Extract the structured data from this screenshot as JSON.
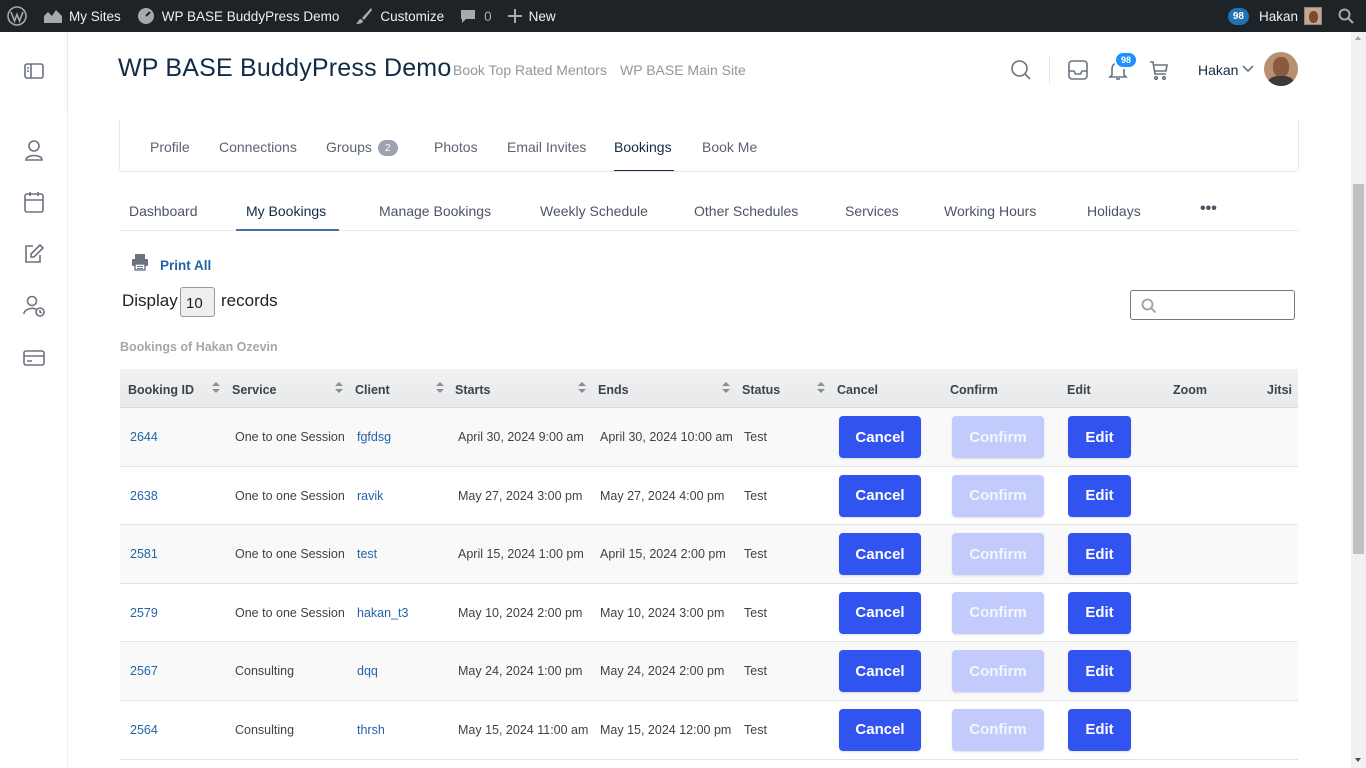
{
  "admin_bar": {
    "my_sites": "My Sites",
    "site_name": "WP BASE BuddyPress Demo",
    "customize": "Customize",
    "comments_count": "0",
    "new_label": "New",
    "updates_badge": "98",
    "user": "Hakan"
  },
  "header": {
    "site_title": "WP BASE BuddyPress Demo",
    "nav": [
      "Book Top Rated Mentors",
      "WP BASE Main Site"
    ],
    "notification_count": "98",
    "user_name": "Hakan"
  },
  "profile_nav": {
    "items": [
      "Profile",
      "Connections",
      "Groups",
      "Photos",
      "Email Invites",
      "Bookings",
      "Book Me"
    ],
    "groups_count": "2",
    "active": "Bookings"
  },
  "sub_nav": {
    "items": [
      "Dashboard",
      "My Bookings",
      "Manage Bookings",
      "Weekly Schedule",
      "Other Schedules",
      "Services",
      "Working Hours",
      "Holidays"
    ],
    "more": "•••",
    "active": "My Bookings"
  },
  "controls": {
    "print_all": "Print All",
    "display_label": "Display",
    "display_value": "10",
    "records_label": "records",
    "search_placeholder": ""
  },
  "table": {
    "caption": "Bookings of Hakan Ozevin",
    "columns": [
      "Booking ID",
      "Service",
      "Client",
      "Starts",
      "Ends",
      "Status",
      "Cancel",
      "Confirm",
      "Edit",
      "Zoom",
      "Jitsi"
    ],
    "buttons": {
      "cancel": "Cancel",
      "confirm": "Confirm",
      "edit": "Edit"
    },
    "rows": [
      {
        "id": "2644",
        "service": "One to one Session",
        "client": "fgfdsg",
        "starts": "April 30, 2024 9:00 am",
        "ends": "April 30, 2024 10:00 am",
        "status": "Test"
      },
      {
        "id": "2638",
        "service": "One to one Session",
        "client": "ravik",
        "starts": "May 27, 2024 3:00 pm",
        "ends": "May 27, 2024 4:00 pm",
        "status": "Test"
      },
      {
        "id": "2581",
        "service": "One to one Session",
        "client": "test",
        "starts": "April 15, 2024 1:00 pm",
        "ends": "April 15, 2024 2:00 pm",
        "status": "Test"
      },
      {
        "id": "2579",
        "service": "One to one Session",
        "client": "hakan_t3",
        "starts": "May 10, 2024 2:00 pm",
        "ends": "May 10, 2024 3:00 pm",
        "status": "Test"
      },
      {
        "id": "2567",
        "service": "Consulting",
        "client": "dqq",
        "starts": "May 24, 2024 1:00 pm",
        "ends": "May 24, 2024 2:00 pm",
        "status": "Test"
      },
      {
        "id": "2564",
        "service": "Consulting",
        "client": "thrsh",
        "starts": "May 15, 2024 11:00 am",
        "ends": "May 15, 2024 12:00 pm",
        "status": "Test"
      }
    ]
  },
  "colors": {
    "primary_button": "#3154f0",
    "disabled_button": "#c2cbfb",
    "link": "#2563a8",
    "admin_bar": "#1d2327"
  }
}
